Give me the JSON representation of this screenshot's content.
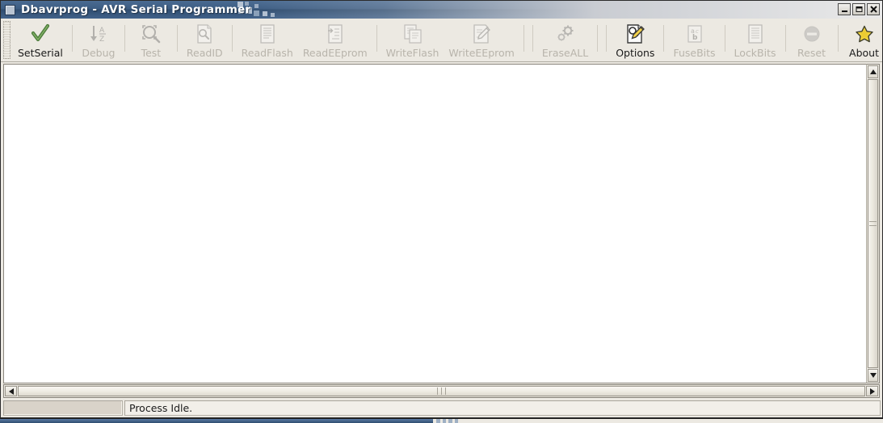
{
  "window": {
    "title": "Dbavrprog - AVR Serial Programmer",
    "icon": "window-app-icon",
    "controls": [
      {
        "name": "minimize",
        "glyph": "minimize-icon"
      },
      {
        "name": "maximize",
        "glyph": "maximize-icon"
      },
      {
        "name": "close",
        "glyph": "close-icon"
      }
    ]
  },
  "toolbar": {
    "items": [
      {
        "id": "setserial",
        "label": "SetSerial",
        "icon": "check-icon",
        "enabled": true
      },
      {
        "id": "debug",
        "label": "Debug",
        "icon": "sort-az-icon",
        "enabled": false
      },
      {
        "id": "test",
        "label": "Test",
        "icon": "magnifier-scan-icon",
        "enabled": false
      },
      {
        "id": "readid",
        "label": "ReadID",
        "icon": "document-search-icon",
        "enabled": false
      },
      {
        "id": "readflash",
        "label": "ReadFlash",
        "icon": "document-lines-icon",
        "enabled": false
      },
      {
        "id": "readeeprom",
        "label": "ReadEEprom",
        "icon": "document-import-icon",
        "enabled": false
      },
      {
        "id": "writeflash",
        "label": "WriteFlash",
        "icon": "documents-copy-icon",
        "enabled": false
      },
      {
        "id": "writeeeprom",
        "label": "WriteEEprom",
        "icon": "document-edit-icon",
        "enabled": false
      },
      {
        "id": "eraseall",
        "label": "EraseALL",
        "icon": "gears-icon",
        "enabled": false
      },
      {
        "id": "options",
        "label": "Options",
        "icon": "document-options-icon",
        "enabled": true
      },
      {
        "id": "fusebits",
        "label": "FuseBits",
        "icon": "abc-box-icon",
        "enabled": false
      },
      {
        "id": "lockbits",
        "label": "LockBits",
        "icon": "document-lines-icon",
        "enabled": false
      },
      {
        "id": "reset",
        "label": "Reset",
        "icon": "no-entry-icon",
        "enabled": false
      },
      {
        "id": "about",
        "label": "About",
        "icon": "star-icon",
        "enabled": true
      }
    ]
  },
  "statusbar": {
    "left_panel": "",
    "message": "Process Idle."
  },
  "colors": {
    "title_bar": "#2f4d70",
    "face": "#ece9e2",
    "canvas": "#ffffff",
    "disabled_text": "#b8b4ab",
    "accent_star": "#f2d53c"
  }
}
